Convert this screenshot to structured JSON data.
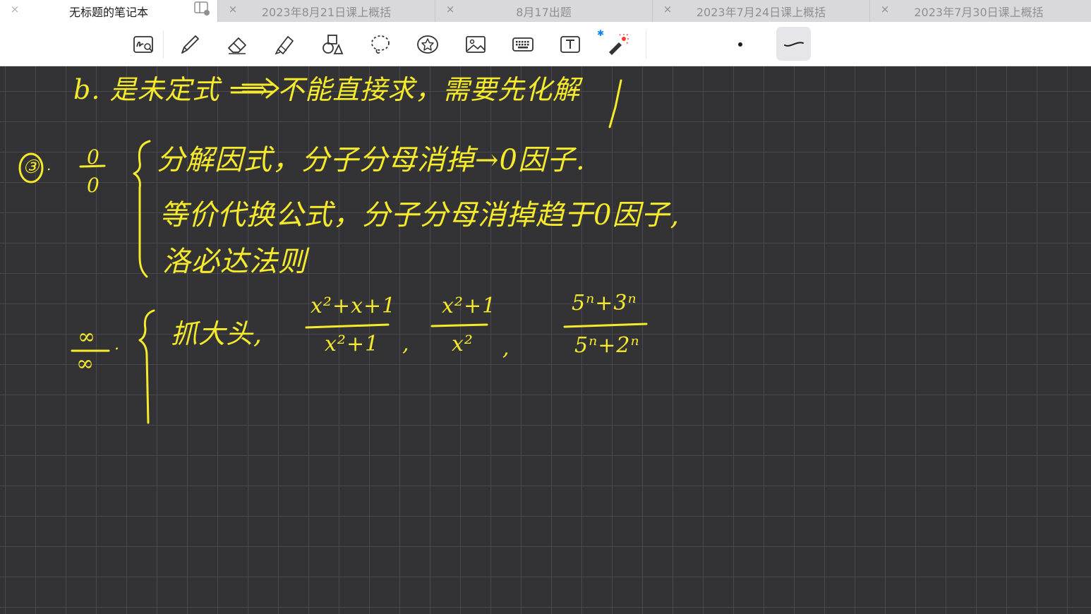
{
  "tabs": [
    {
      "title": "无标题的笔记本",
      "active": true
    },
    {
      "title": "2023年8月21日课上概括",
      "active": false
    },
    {
      "title": "8月17出题",
      "active": false
    },
    {
      "title": "2023年7月24日课上概括",
      "active": false
    },
    {
      "title": "2023年7月30日课上概括",
      "active": false
    }
  ],
  "tab_close_glyph": "×",
  "toolbar": {
    "tools": [
      {
        "name": "handwriting-zoom-icon"
      },
      {
        "name": "pen-icon"
      },
      {
        "name": "eraser-icon"
      },
      {
        "name": "highlighter-icon"
      },
      {
        "name": "shapes-icon"
      },
      {
        "name": "lasso-icon"
      },
      {
        "name": "sticker-icon"
      },
      {
        "name": "image-icon"
      },
      {
        "name": "keyboard-icon"
      },
      {
        "name": "text-box-icon"
      },
      {
        "name": "laser-pointer-icon"
      }
    ],
    "bluetooth_glyph": "✱"
  },
  "colors": {
    "ink": "#f5ea2b",
    "canvas": "#333336",
    "grid": "#4a4a4e",
    "laser_red": "#ff3b30",
    "bluetooth_blue": "#0a84ff"
  },
  "notes": {
    "line1": "b. 是未定式 ⟹ 不能直接求，需要先化解",
    "item3_marker": "③.",
    "case_0_0": {
      "num": "0",
      "den": "0",
      "lines": [
        "分解因式，分子分母消掉→0因子.",
        "等价代换公式，分子分母消掉趋于0因子,",
        "洛必达法则"
      ]
    },
    "case_inf": {
      "num": "∞",
      "den": "∞",
      "dot": ".",
      "lead": "抓大头,",
      "examples": [
        {
          "num": "x²+x+1",
          "den": "x²+1"
        },
        {
          "num": "x²+1",
          "den": "x²"
        },
        {
          "num": "5ⁿ+3ⁿ",
          "den": "5ⁿ+2ⁿ"
        }
      ],
      "comma": ","
    }
  }
}
